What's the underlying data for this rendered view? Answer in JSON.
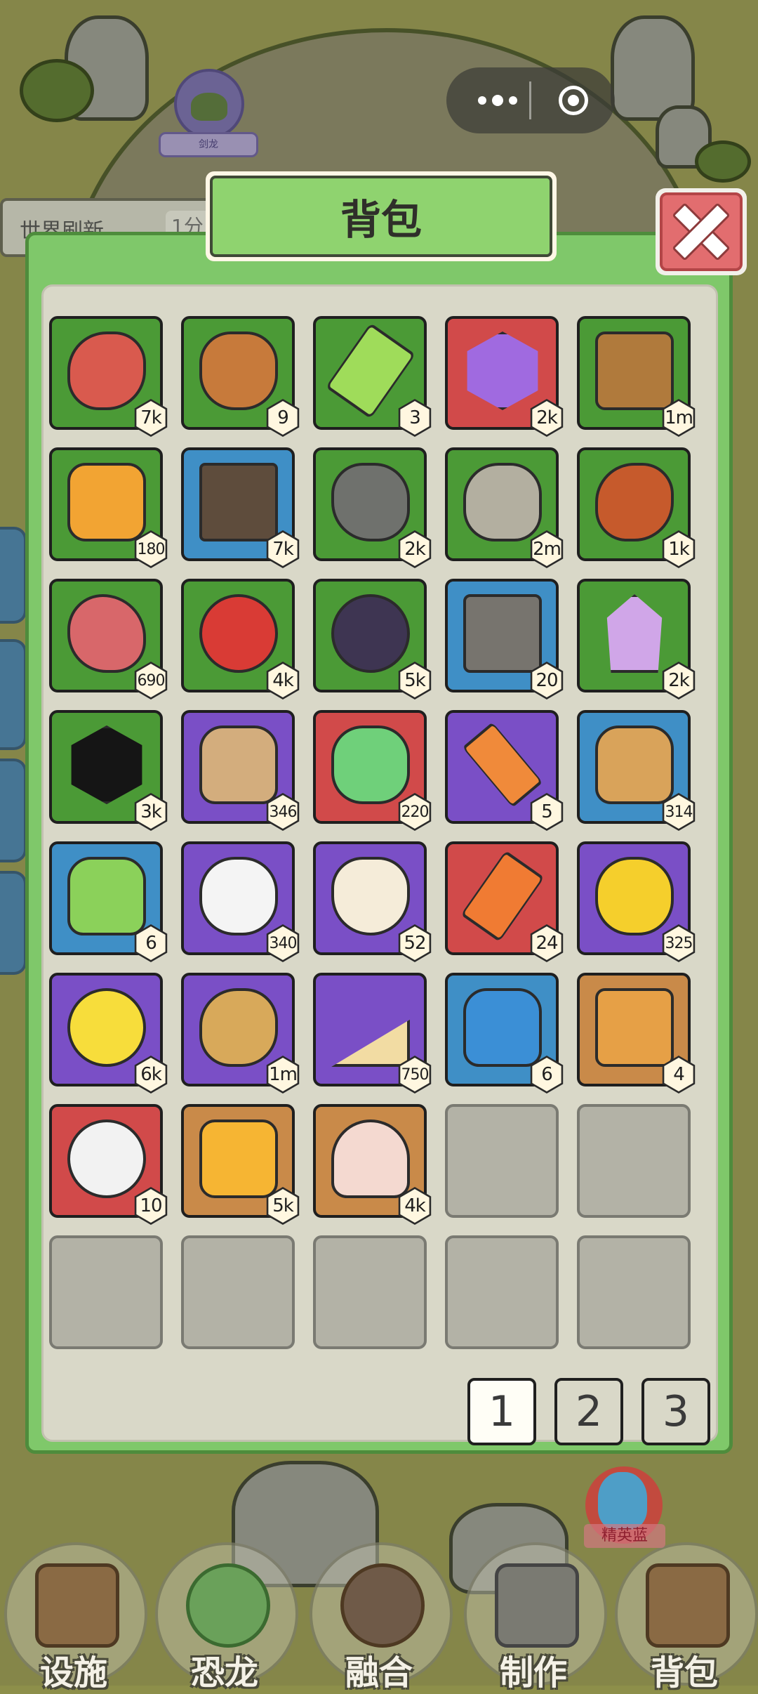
{
  "background": {
    "dino_label": "剑龙",
    "world_refresh_label": "世界刷新",
    "world_refresh_time": "1分"
  },
  "capsule": {
    "more_icon": "more-dots-icon",
    "close_icon": "target-circle-icon"
  },
  "modal": {
    "title": "背包",
    "close_icon": "close-x-icon",
    "slots": [
      {
        "icon": "meat-leg-icon",
        "bg": "#4b9a36",
        "count": "7k"
      },
      {
        "icon": "clay-pot-icon",
        "bg": "#4b9a36",
        "count": "9"
      },
      {
        "icon": "green-syringe-icon",
        "bg": "#4b9a36",
        "count": "3"
      },
      {
        "icon": "purple-gem-icon",
        "bg": "#d14a4a",
        "count": "2k"
      },
      {
        "icon": "wood-stump-icon",
        "bg": "#4b9a36",
        "count": "1m"
      },
      {
        "icon": "amber-icon",
        "bg": "#4b9a36",
        "count": "180"
      },
      {
        "icon": "coal-cart-icon",
        "bg": "#3f8fc6",
        "count": "7k"
      },
      {
        "icon": "iron-ore-icon",
        "bg": "#4b9a36",
        "count": "2k"
      },
      {
        "icon": "stone-icon",
        "bg": "#4b9a36",
        "count": "2m"
      },
      {
        "icon": "roast-leg-icon",
        "bg": "#4b9a36",
        "count": "1k"
      },
      {
        "icon": "steak-icon",
        "bg": "#4b9a36",
        "count": "690"
      },
      {
        "icon": "red-berries-icon",
        "bg": "#4b9a36",
        "count": "4k"
      },
      {
        "icon": "blackberry-icon",
        "bg": "#4b9a36",
        "count": "5k"
      },
      {
        "icon": "iron-ingot-icon",
        "bg": "#3f8fc6",
        "count": "20"
      },
      {
        "icon": "crystal-icon",
        "bg": "#4b9a36",
        "count": "2k"
      },
      {
        "icon": "obsidian-icon",
        "bg": "#4b9a36",
        "count": "3k"
      },
      {
        "icon": "cnet-sack-icon",
        "bg": "#7a4fc6",
        "count": "346"
      },
      {
        "icon": "potion-icon",
        "bg": "#d14a4a",
        "count": "220"
      },
      {
        "icon": "arrow-syringe-icon",
        "bg": "#7a4fc6",
        "count": "5"
      },
      {
        "icon": "seed-sack-icon",
        "bg": "#3f8fc6",
        "count": "314"
      },
      {
        "icon": "green-sack-icon",
        "bg": "#3f8fc6",
        "count": "6"
      },
      {
        "icon": "egg-pile-icon",
        "bg": "#7a4fc6",
        "count": "340"
      },
      {
        "icon": "fang-icon",
        "bg": "#7a4fc6",
        "count": "52"
      },
      {
        "icon": "orange-syringe-icon",
        "bg": "#d14a4a",
        "count": "24"
      },
      {
        "icon": "corn-icon",
        "bg": "#7a4fc6",
        "count": "325"
      },
      {
        "icon": "lemon-icon",
        "bg": "#7a4fc6",
        "count": "6k"
      },
      {
        "icon": "potato-icon",
        "bg": "#7a4fc6",
        "count": "1m"
      },
      {
        "icon": "sandwich-icon",
        "bg": "#7a4fc6",
        "count": "750"
      },
      {
        "icon": "blue-sack-icon",
        "bg": "#3f8fc6",
        "count": "6"
      },
      {
        "icon": "leopard-hide-icon",
        "bg": "#c98a49",
        "count": "4"
      },
      {
        "icon": "eyeball-icon",
        "bg": "#d14a4a",
        "count": "10"
      },
      {
        "icon": "honey-jar-icon",
        "bg": "#c98a49",
        "count": "5k"
      },
      {
        "icon": "pearl-shell-icon",
        "bg": "#c98a49",
        "count": "4k"
      },
      {
        "empty": true
      },
      {
        "empty": true
      },
      {
        "empty": true
      },
      {
        "empty": true
      },
      {
        "empty": true
      },
      {
        "empty": true
      },
      {
        "empty": true
      }
    ],
    "pages": [
      "1",
      "2",
      "3"
    ],
    "active_page": "1"
  },
  "bottom_nav": [
    {
      "label": "设施",
      "icon": "fence-icon"
    },
    {
      "label": "恐龙",
      "icon": "dino-globe-icon"
    },
    {
      "label": "融合",
      "icon": "fusion-icon"
    },
    {
      "label": "制作",
      "icon": "hammer-icon"
    },
    {
      "label": "背包",
      "icon": "backpack-icon"
    }
  ],
  "promo": {
    "label": "精英蓝"
  }
}
